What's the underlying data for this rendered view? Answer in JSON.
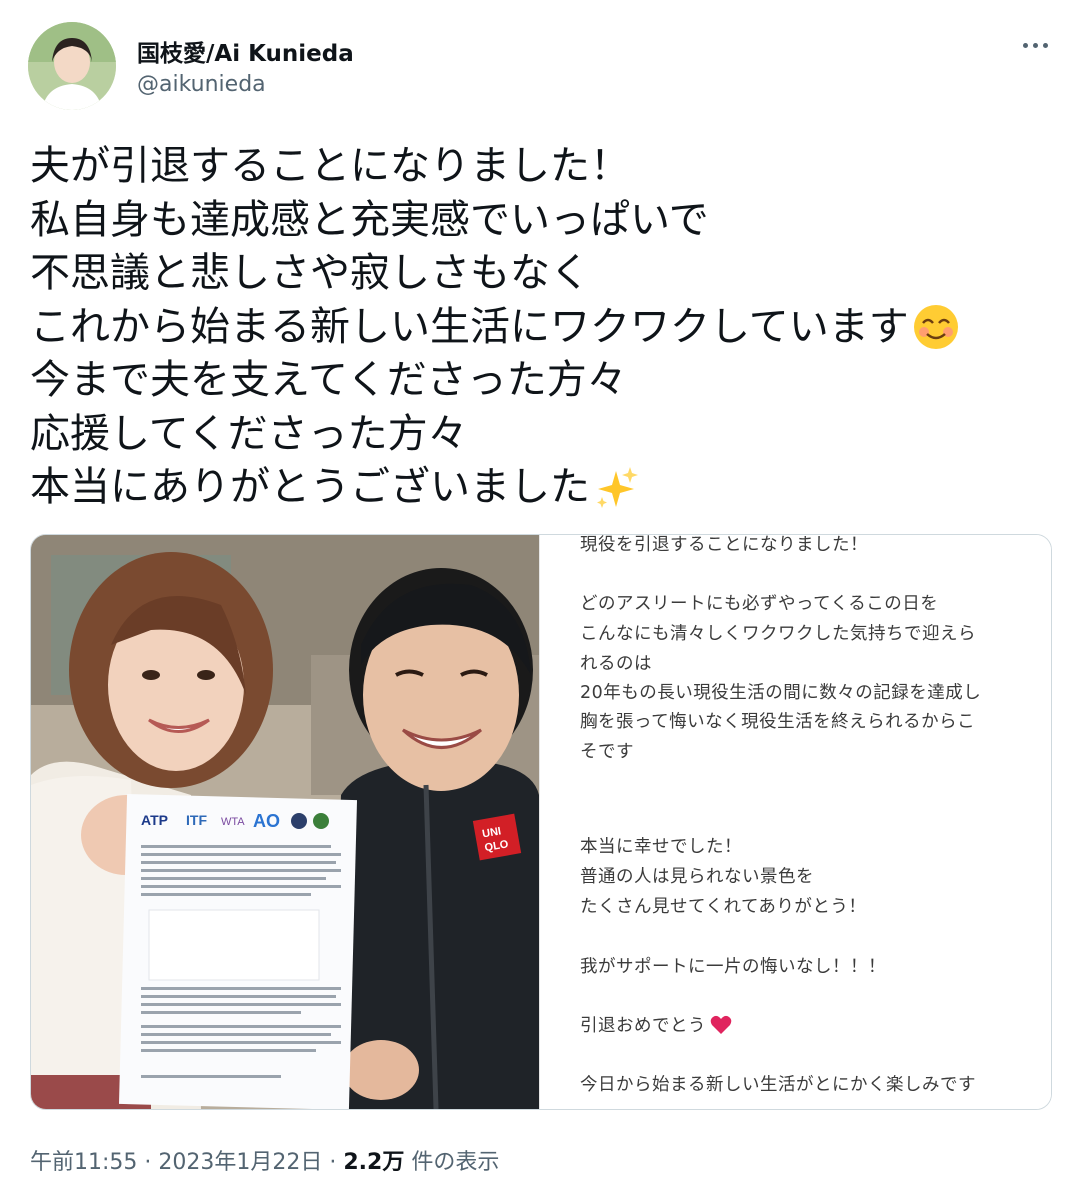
{
  "author": {
    "display_name": "国枝愛/Ai Kunieda",
    "handle": "@aikunieda"
  },
  "tweet": {
    "lines": [
      "夫が引退することになりました！",
      "私自身も達成感と充実感でいっぱいで",
      "不思議と悲しさや寂しさもなく",
      "これから始まる新しい生活にワクワクしています",
      "今まで夫を支えてくださった方々",
      "応援してくださった方々",
      "本当にありがとうございました"
    ],
    "emojis": [
      "smiling-face-icon",
      "sparkles-icon"
    ]
  },
  "media": {
    "photo_brand": "UNI QLO",
    "paper_logos": [
      "ATP",
      "ITF",
      "WTA",
      "AO"
    ],
    "note_lines": [
      "現役を引退することになりました！",
      "",
      "どのアスリートにも必ずやってくるこの日を",
      "こんなにも清々しくワクワクした気持ちで迎えら",
      "れるのは",
      "20年もの長い現役生活の間に数々の記録を達成し",
      "胸を張って悔いなく現役生活を終えられるからこ",
      "そです",
      "",
      "",
      "本当に幸せでした！",
      "普通の人は見られない景色を",
      "たくさん見せてくれてありがとう！",
      "",
      "我がサポートに一片の悔いなし！！！",
      "",
      "引退おめでとう",
      "",
      "今日から始まる新しい生活がとにかく楽しみです"
    ]
  },
  "meta": {
    "time": "午前11:55",
    "separator": " · ",
    "date": "2023年1月22日",
    "views_count": "2.2万",
    "views_label": " 件の表示"
  },
  "colors": {
    "text": "#0f1419",
    "secondary": "#536471",
    "border": "#cfd9de",
    "heart": "#e0245e",
    "brand_red": "#d21f26"
  }
}
